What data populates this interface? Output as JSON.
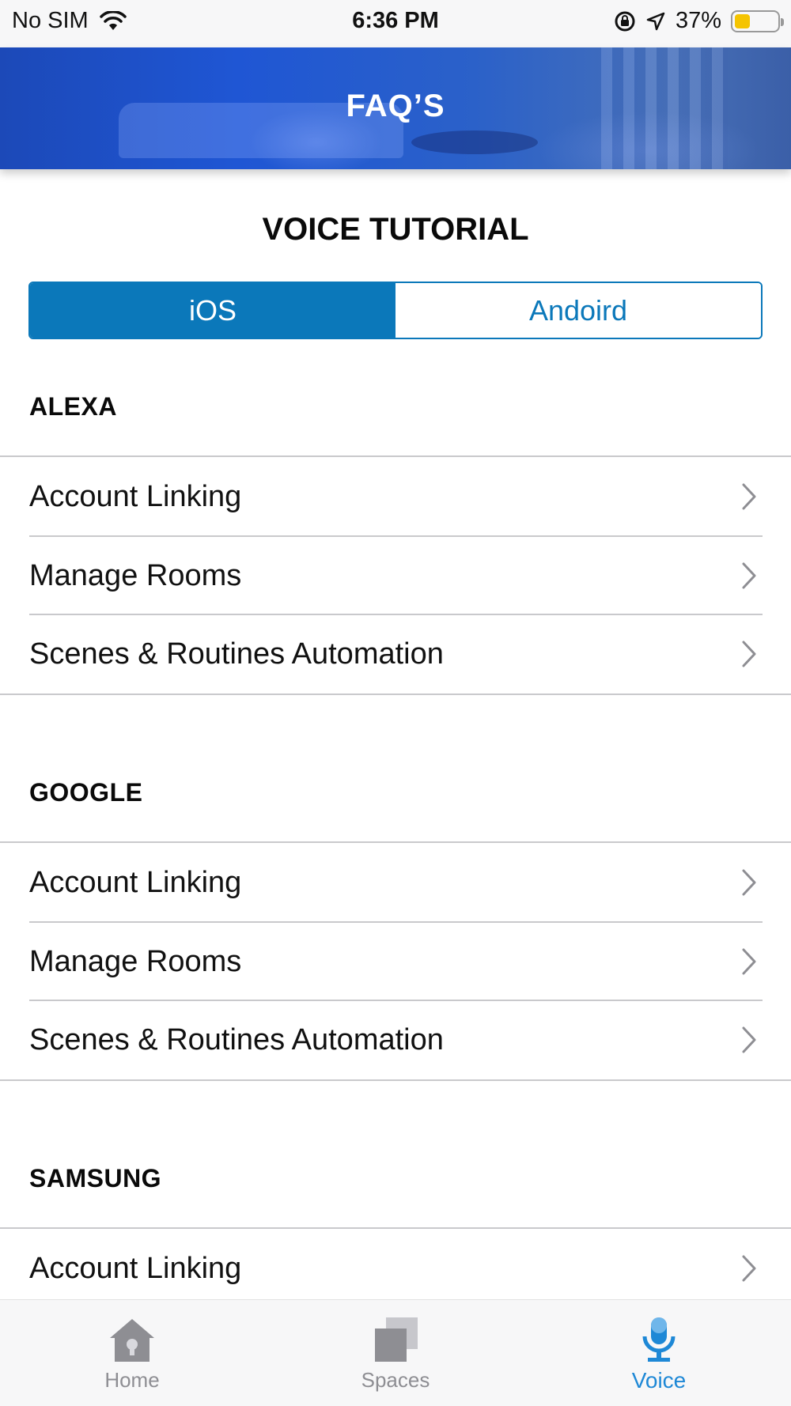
{
  "status_bar": {
    "carrier": "No SIM",
    "time": "6:36 PM",
    "battery_percent": "37%",
    "battery_level": 0.37,
    "icons": [
      "wifi-icon",
      "orientation-lock-icon",
      "location-arrow-icon",
      "battery-icon"
    ]
  },
  "header": {
    "title": "FAQ’S"
  },
  "page": {
    "heading": "VOICE TUTORIAL"
  },
  "platform_toggle": {
    "options": [
      "iOS",
      "Andoird"
    ],
    "selected": "iOS",
    "colors": {
      "accent": "#0b78ba"
    }
  },
  "sections": [
    {
      "title": "ALEXA",
      "items": [
        "Account Linking",
        "Manage Rooms",
        "Scenes & Routines Automation"
      ]
    },
    {
      "title": "GOOGLE",
      "items": [
        "Account Linking",
        "Manage Rooms",
        "Scenes & Routines Automation"
      ]
    },
    {
      "title": "SAMSUNG",
      "items": [
        "Account Linking"
      ]
    }
  ],
  "tab_bar": {
    "tabs": [
      {
        "label": "Home",
        "icon": "home-icon"
      },
      {
        "label": "Spaces",
        "icon": "spaces-icon"
      },
      {
        "label": "Voice",
        "icon": "microphone-icon"
      }
    ],
    "active": "Voice",
    "colors": {
      "active": "#1e88d6",
      "inactive": "#8e8e93"
    }
  }
}
